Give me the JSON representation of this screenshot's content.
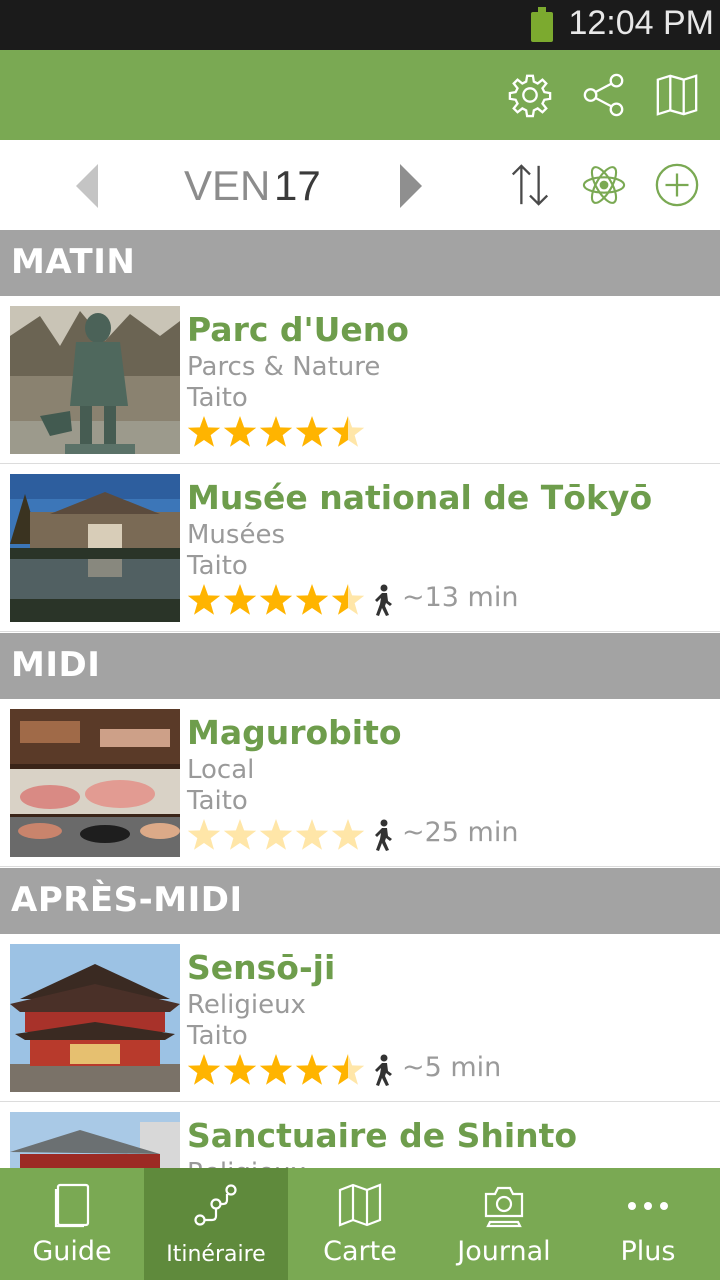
{
  "status_bar": {
    "time": "12:04 PM"
  },
  "toolbar": {
    "icons": [
      "gear-icon",
      "share-icon",
      "map-icon"
    ]
  },
  "date_nav": {
    "day_name": "VEN",
    "day_number": "17",
    "icons": [
      "sort-icon",
      "atom-icon",
      "add-icon"
    ]
  },
  "colors": {
    "accent": "#7aa953",
    "title_green": "#6e9d4c",
    "section_gray": "#a3a3a3",
    "star": "#ffb400"
  },
  "sections": [
    {
      "label": "MATIN"
    },
    {
      "label": "MIDI"
    },
    {
      "label": "APRÈS-MIDI"
    }
  ],
  "items": [
    {
      "title": "Parc d'Ueno",
      "category": "Parcs & Nature",
      "area": "Taito",
      "rating": 4.5,
      "walk_time": ""
    },
    {
      "title": "Musée national de Tōkyō",
      "category": "Musées",
      "area": "Taito",
      "rating": 4.5,
      "walk_time": "~13 min"
    },
    {
      "title": "Magurobito",
      "category": "Local",
      "area": "Taito",
      "rating": 0,
      "walk_time": "~25 min"
    },
    {
      "title": "Sensō-ji",
      "category": "Religieux",
      "area": "Taito",
      "rating": 4.5,
      "walk_time": "~5 min"
    },
    {
      "title": "Sanctuaire de Shinto",
      "category": "Religieux",
      "area": "",
      "rating": 0,
      "walk_time": ""
    }
  ],
  "bottom_nav": {
    "tabs": [
      {
        "label": "Guide",
        "icon": "book-icon"
      },
      {
        "label": "Itinéraire",
        "icon": "route-icon",
        "active": true
      },
      {
        "label": "Carte",
        "icon": "map-icon"
      },
      {
        "label": "Journal",
        "icon": "camera-icon"
      },
      {
        "label": "Plus",
        "icon": "more-icon"
      }
    ]
  }
}
